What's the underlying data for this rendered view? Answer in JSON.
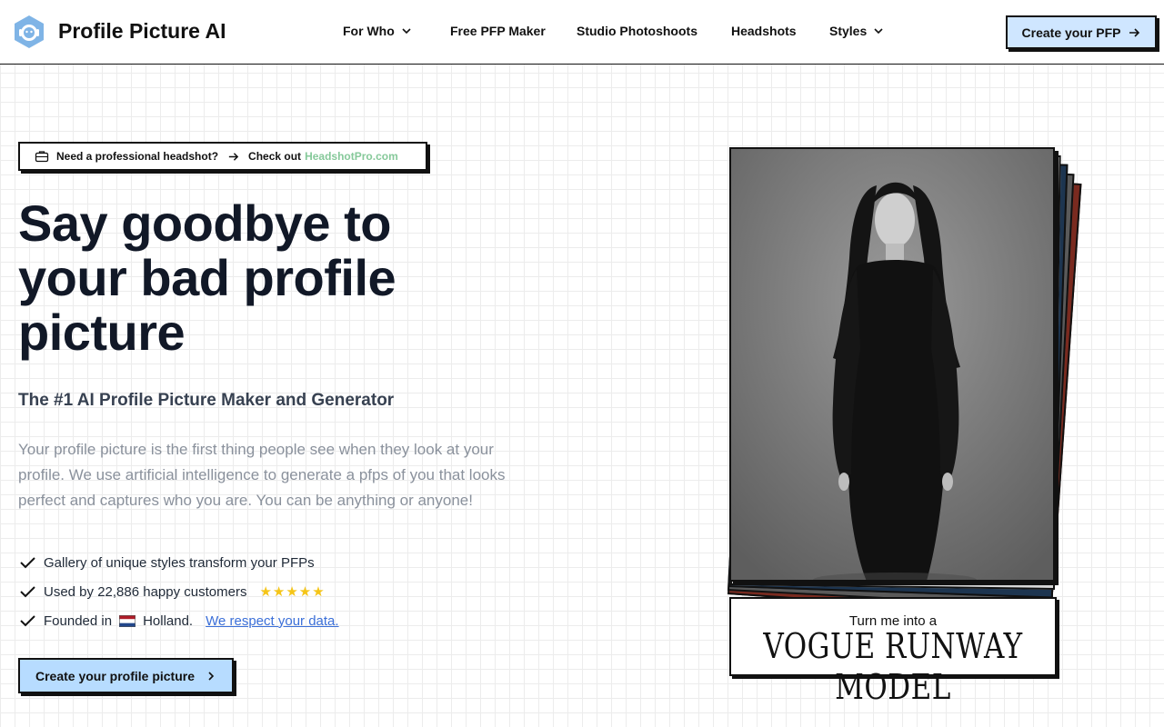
{
  "nav": {
    "brand": "Profile Picture AI",
    "items": [
      {
        "label": "For Who",
        "dropdown": true
      },
      {
        "label": "Free PFP Maker",
        "dropdown": false
      },
      {
        "label": "Studio Photoshoots",
        "dropdown": false
      },
      {
        "label": "Headshots",
        "dropdown": false
      },
      {
        "label": "Styles",
        "dropdown": true
      }
    ],
    "cta": "Create your PFP"
  },
  "promo": {
    "question": "Need a professional headshot?",
    "check": "Check out",
    "site": "HeadshotPro.com"
  },
  "hero": {
    "headline_line1": "Say goodbye to",
    "headline_line2": "your bad profile",
    "headline_line3": "picture",
    "subhead": "The #1 AI Profile Picture Maker and Generator",
    "description": "Your profile picture is the first thing people see when they look at your profile. We use artificial intelligence to generate a pfps of you that looks perfect and captures who you are. You can be anything or anyone!",
    "features": {
      "f1": "Gallery of unique styles transform your PFPs",
      "f2": "Used by 22,886 happy customers",
      "f2_stars": "★★★★★",
      "f3_prefix": "Founded in",
      "f3_place": "Holland.",
      "f3_link": "We respect your data."
    },
    "cta": "Create your profile picture"
  },
  "showcase": {
    "caption_small": "Turn me into a",
    "caption_big": "VOGUE RUNWAY MODEL"
  },
  "colors": {
    "cta_bg": "#b7dcff",
    "link": "#3b6fd8",
    "promo_site": "#86c99a",
    "stars": "#f5c518"
  }
}
